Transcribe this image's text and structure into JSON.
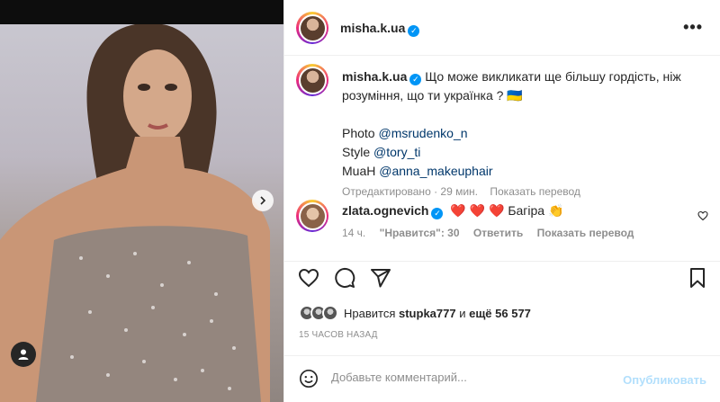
{
  "post": {
    "author": "misha.k.ua",
    "more_label": "•••"
  },
  "caption": {
    "author": "misha.k.ua",
    "text": "Що може викликати ще більшу гордість, ніж розуміння, що ти українка ?",
    "flag_emoji": "🇺🇦",
    "credits": [
      {
        "label": "Photo ",
        "mention": "@msrudenko_n"
      },
      {
        "label": "Style ",
        "mention": "@tory_ti"
      },
      {
        "label": "MuaH ",
        "mention": "@anna_makeuphair"
      }
    ],
    "edited_label": "Отредактировано",
    "edited_time": "29 мин.",
    "translate_label": "Показать перевод"
  },
  "comment": {
    "author": "zlata.ognevich",
    "text": "❤️ ❤️ ❤️  Багіра 👏",
    "time": "14 ч.",
    "likes_label": "\"Нравится\": 30",
    "reply_label": "Ответить",
    "translate_label": "Показать перевод"
  },
  "likes": {
    "prefix": "Нравится",
    "user": "stupka777",
    "conj": "и",
    "rest": "ещё 56 577"
  },
  "time_ago": "15 ЧАСОВ НАЗАД",
  "composer": {
    "placeholder": "Добавьте комментарий...",
    "publish_label": "Опубликовать"
  },
  "colors": {
    "accent": "#0095f6",
    "mention": "#00376b",
    "muted": "#8e8e8e",
    "publish_disabled": "#b2dffc"
  }
}
